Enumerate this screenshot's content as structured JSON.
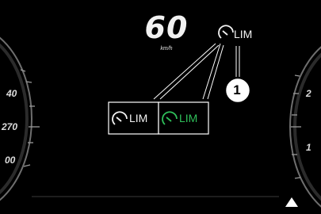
{
  "speed": {
    "value": "60",
    "unit": "km/h"
  },
  "limiter": {
    "label": "LIM",
    "icon": "speed-limiter-icon",
    "colors": {
      "white": "#f2f2f2",
      "active": "#2fc05a"
    }
  },
  "callout": {
    "number": "1"
  },
  "left_gauge": {
    "labels": [
      "40",
      "270",
      "00"
    ]
  },
  "right_gauge": {
    "labels": [
      "2",
      "1"
    ]
  },
  "warning": {
    "icon": "triangle-up-icon"
  }
}
